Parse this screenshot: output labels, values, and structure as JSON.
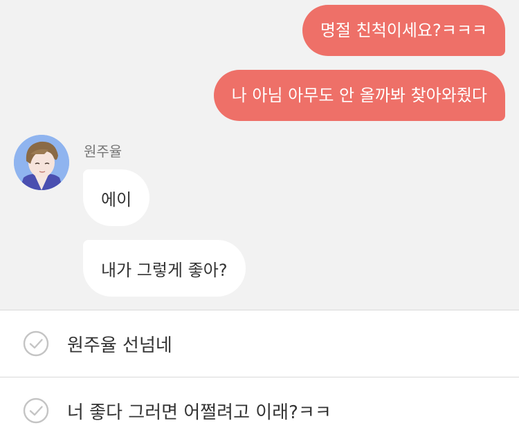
{
  "messages_outgoing": [
    {
      "text": "명절 친척이세요?ㅋㅋㅋ"
    },
    {
      "text": "나 아님 아무도 안 올까봐 찾아와줬다"
    }
  ],
  "incoming": {
    "sender": "원주율",
    "avatar_icon": "character-portrait",
    "messages": [
      {
        "text": "에이"
      },
      {
        "text": "내가 그렇게 좋아?"
      }
    ]
  },
  "reply_options": [
    {
      "text": "원주율 선넘네",
      "icon": "check-circle-icon"
    },
    {
      "text": "너 좋다 그러면 어쩔려고 이래?ㅋㅋ",
      "icon": "check-circle-icon"
    }
  ],
  "colors": {
    "outgoing_bubble": "#ee7068",
    "incoming_bubble": "#ffffff",
    "chat_background": "#f2f2f2"
  }
}
